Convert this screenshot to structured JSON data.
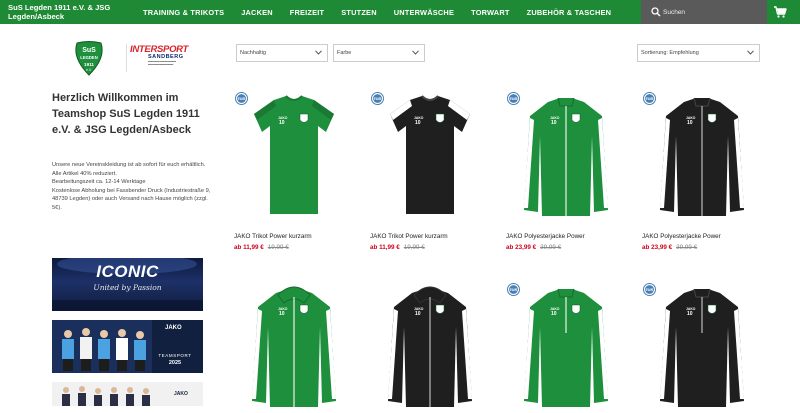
{
  "header": {
    "store_name": "SuS Legden 1911 e.V. & JSG Legden/Asbeck",
    "nav": [
      "TRAINING & TRIKOTS",
      "JACKEN",
      "FREIZEIT",
      "STUTZEN",
      "UNTERWÄSCHE",
      "TORWART",
      "ZUBEHÖR & TASCHEN"
    ],
    "search_placeholder": "Suchen"
  },
  "logos": {
    "club_line1": "SuS",
    "club_line2": "LEGDEN",
    "club_year": "1911",
    "club_suffix": "e.V.",
    "intersport_name": "INTERSPORT",
    "intersport_location": "SANDBERG"
  },
  "sidebar": {
    "welcome": "Herzlich Willkommen im Teamshop SuS Legden 1911 e.V. & JSG Legden/Asbeck",
    "intro": [
      "Unsere neue Vereinskleidung ist ab sofort für euch erhältlich.",
      "Alle Artikel 40% reduziert.",
      "Bearbeitungszeit ca. 12-14 Werktage",
      "Kostenlose Abholung bei Fassbender Druck (Industriestraße 9, 48739 Legden) oder auch Versand nach Hause möglich (zzgl. 5€)."
    ],
    "banner1_title": "ICONIC",
    "banner1_sub": "United by Passion",
    "banner2_brand": "JAKO",
    "banner2_label": "TEAMSPORT",
    "banner2_year": "2025",
    "banner3_brand": "JAKO"
  },
  "filters": {
    "sustainable": "Nachhaltig",
    "color": "Farbe",
    "sort": "Sortierung: Empfehlung"
  },
  "badge_text": "FAIR",
  "shirt_number": "10",
  "products": [
    {
      "name": "JAKO Trikot Power kurzarm",
      "price": "ab 11,99 €",
      "old_price": "19,99 €",
      "color": "#1e8f3c",
      "trim": "#ffffff",
      "kind": "tshirt",
      "badge": true
    },
    {
      "name": "JAKO Trikot Power kurzarm",
      "price": "ab 11,99 €",
      "old_price": "19,99 €",
      "color": "#1f1f1f",
      "trim": "#ffffff",
      "kind": "tshirt",
      "badge": true
    },
    {
      "name": "JAKO Polyesterjacke Power",
      "price": "ab 23,99 €",
      "old_price": "39,99 €",
      "color": "#1e8f3c",
      "trim": "#ffffff",
      "kind": "jacket",
      "badge": true
    },
    {
      "name": "JAKO Polyesterjacke Power",
      "price": "ab 23,99 €",
      "old_price": "39,99 €",
      "color": "#1f1f1f",
      "trim": "#ffffff",
      "kind": "jacket",
      "badge": true
    },
    {
      "name": "",
      "price": "",
      "old_price": "",
      "color": "#1e8f3c",
      "trim": "#ffffff",
      "kind": "hoodie",
      "badge": false
    },
    {
      "name": "",
      "price": "",
      "old_price": "",
      "color": "#1f1f1f",
      "trim": "#ffffff",
      "kind": "hoodie",
      "badge": false
    },
    {
      "name": "",
      "price": "",
      "old_price": "",
      "color": "#1e8f3c",
      "trim": "#ffffff",
      "kind": "halfzip",
      "badge": true
    },
    {
      "name": "",
      "price": "",
      "old_price": "",
      "color": "#1f1f1f",
      "trim": "#ffffff",
      "kind": "halfzip",
      "badge": true
    }
  ],
  "colors": {
    "brand_green": "#1f8a35",
    "price_red": "#d0021b",
    "search_bg": "#5a5a5a"
  }
}
